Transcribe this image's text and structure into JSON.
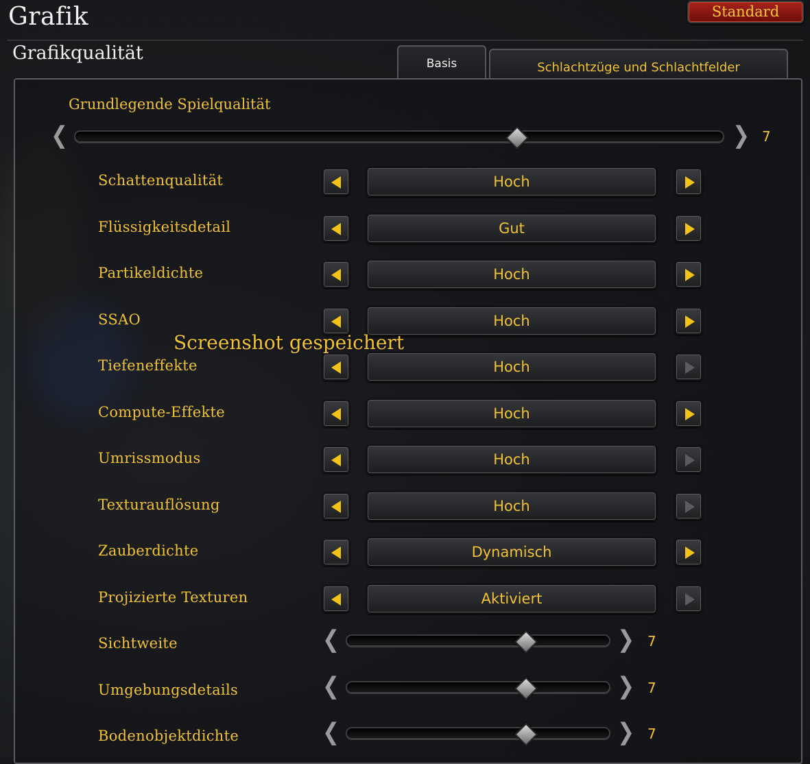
{
  "window": {
    "title": "Grafik",
    "reset_button": "Standard"
  },
  "section": {
    "title": "Grafikqualität"
  },
  "tabs": [
    {
      "label": "Basis",
      "active": true
    },
    {
      "label": "Schlachtzüge und Schlachtfelder",
      "active": false
    }
  ],
  "base_quality": {
    "label": "Grundlegende Spielqualität",
    "value": "7",
    "level": 7,
    "max": 10
  },
  "settings": [
    {
      "label": "Schattenqualität",
      "value": "Hoch",
      "prev_enabled": true,
      "next_enabled": true
    },
    {
      "label": "Flüssigkeitsdetail",
      "value": "Gut",
      "prev_enabled": true,
      "next_enabled": true
    },
    {
      "label": "Partikeldichte",
      "value": "Hoch",
      "prev_enabled": true,
      "next_enabled": true
    },
    {
      "label": "SSAO",
      "value": "Hoch",
      "prev_enabled": true,
      "next_enabled": true
    },
    {
      "label": "Tiefeneffekte",
      "value": "Hoch",
      "prev_enabled": true,
      "next_enabled": false
    },
    {
      "label": "Compute-Effekte",
      "value": "Hoch",
      "prev_enabled": true,
      "next_enabled": true
    },
    {
      "label": "Umrissmodus",
      "value": "Hoch",
      "prev_enabled": true,
      "next_enabled": false
    },
    {
      "label": "Texturauflösung",
      "value": "Hoch",
      "prev_enabled": true,
      "next_enabled": false
    },
    {
      "label": "Zauberdichte",
      "value": "Dynamisch",
      "prev_enabled": true,
      "next_enabled": true
    },
    {
      "label": "Projizierte Texturen",
      "value": "Aktiviert",
      "prev_enabled": true,
      "next_enabled": false
    }
  ],
  "sliders": [
    {
      "label": "Sichtweite",
      "value": "7",
      "level": 7,
      "max": 10
    },
    {
      "label": "Umgebungsdetails",
      "value": "7",
      "level": 7,
      "max": 10
    },
    {
      "label": "Bodenobjektdichte",
      "value": "7",
      "level": 7,
      "max": 10
    }
  ],
  "notification": "Screenshot gespeichert",
  "colors": {
    "accent": "#f1c232",
    "reset_button": "#8f1710"
  }
}
